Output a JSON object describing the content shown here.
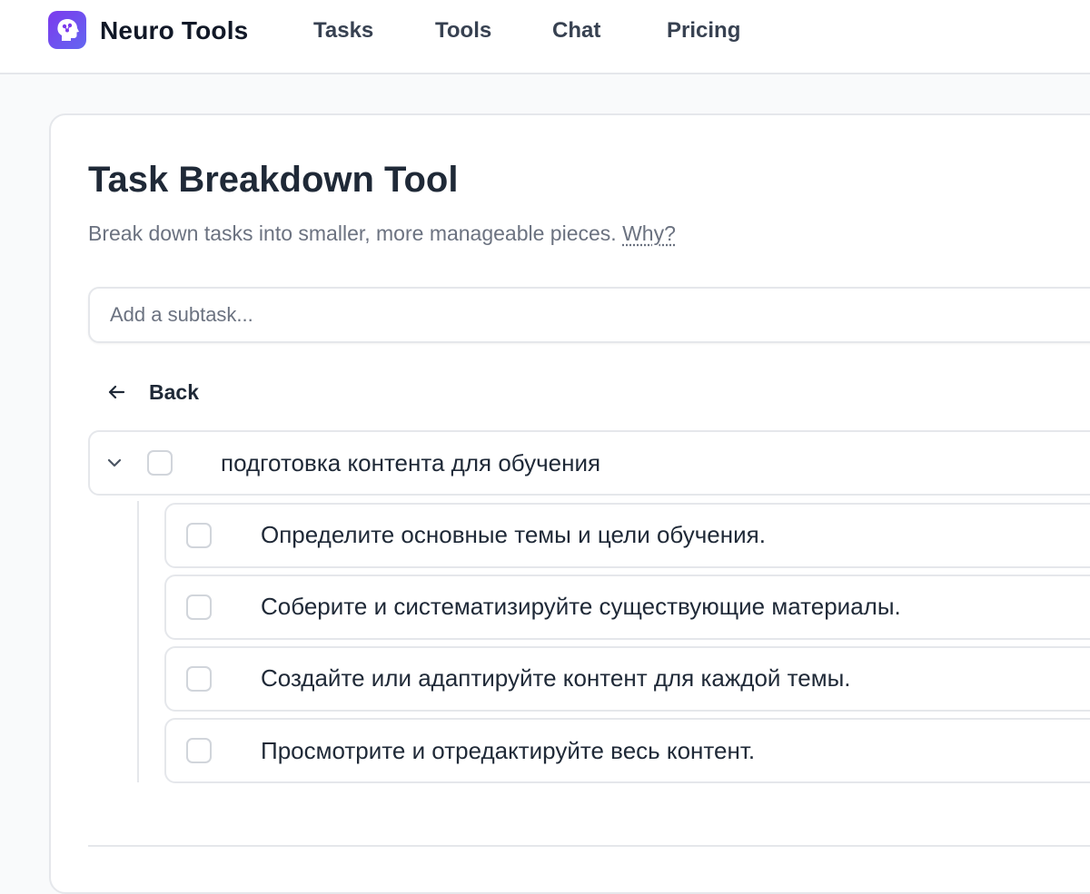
{
  "header": {
    "brand": "Neuro Tools",
    "nav": [
      "Tasks",
      "Tools",
      "Chat",
      "Pricing"
    ],
    "logo_icon": "brain-head-icon",
    "accent": "#7c3aed"
  },
  "page": {
    "title": "Task Breakdown Tool",
    "subtitle": "Break down tasks into smaller, more manageable pieces.",
    "why_link": "Why?"
  },
  "subtask_input": {
    "placeholder": "Add a subtask...",
    "value": ""
  },
  "back": {
    "label": "Back",
    "icon": "arrow-left-icon"
  },
  "task": {
    "label": "подготовка контента для обучения",
    "checked": false,
    "expanded": true,
    "subtasks": [
      {
        "label": "Определите основные темы и цели обучения.",
        "checked": false
      },
      {
        "label": "Соберите и систематизируйте существующие материалы.",
        "checked": false
      },
      {
        "label": "Создайте или адаптируйте контент для каждой темы.",
        "checked": false
      },
      {
        "label": "Просмотрите и отредактируйте весь контент.",
        "checked": false
      }
    ]
  }
}
